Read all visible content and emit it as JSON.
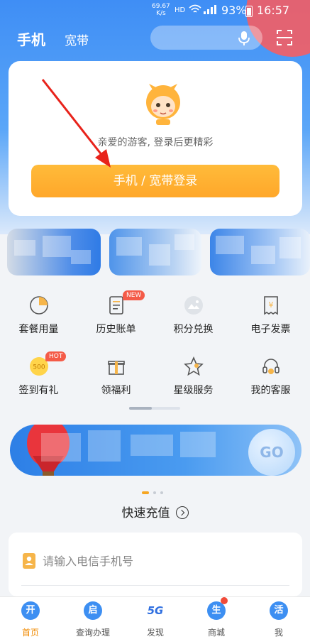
{
  "status_bar": {
    "net_speed_value": "69.67",
    "net_speed_unit": "K/s",
    "hd": "HD",
    "battery": "93%",
    "time": "16:57"
  },
  "header": {
    "tabs": [
      "手机",
      "宽带"
    ],
    "icons": [
      "mic-icon",
      "scan-icon"
    ]
  },
  "login_card": {
    "guest_text": "亲爱的游客, 登录后更精彩",
    "login_button": "手机 / 宽带登录"
  },
  "grid": {
    "items": [
      {
        "label": "套餐用量",
        "icon": "pie-chart-icon"
      },
      {
        "label": "历史账单",
        "icon": "bill-icon",
        "badge": "NEW"
      },
      {
        "label": "积分兑换",
        "icon": "points-icon"
      },
      {
        "label": "电子发票",
        "icon": "invoice-icon"
      },
      {
        "label": "签到有礼",
        "icon": "coin-icon",
        "badge": "HOT",
        "icon_text": "500"
      },
      {
        "label": "领福利",
        "icon": "gift-icon"
      },
      {
        "label": "星级服务",
        "icon": "star-icon"
      },
      {
        "label": "我的客服",
        "icon": "headset-icon"
      }
    ]
  },
  "promo_banner": {
    "go_label": "GO",
    "active_page": 1,
    "page_count": 3
  },
  "quick_recharge": {
    "title": "快速充值",
    "placeholder": "请输入电信手机号"
  },
  "bottom_nav": {
    "items": [
      {
        "label": "首页",
        "glyph": "开",
        "active": true
      },
      {
        "label": "查询办理",
        "glyph": "启"
      },
      {
        "label": "发现",
        "glyph": "5G"
      },
      {
        "label": "商城",
        "glyph": "生",
        "dot": true
      },
      {
        "label": "我",
        "glyph": "活"
      }
    ]
  },
  "colors": {
    "brand_blue": "#3d8ff2",
    "login_orange": "#ffa72a",
    "active_nav": "#f08a00",
    "badge_red": "#f45b48"
  }
}
